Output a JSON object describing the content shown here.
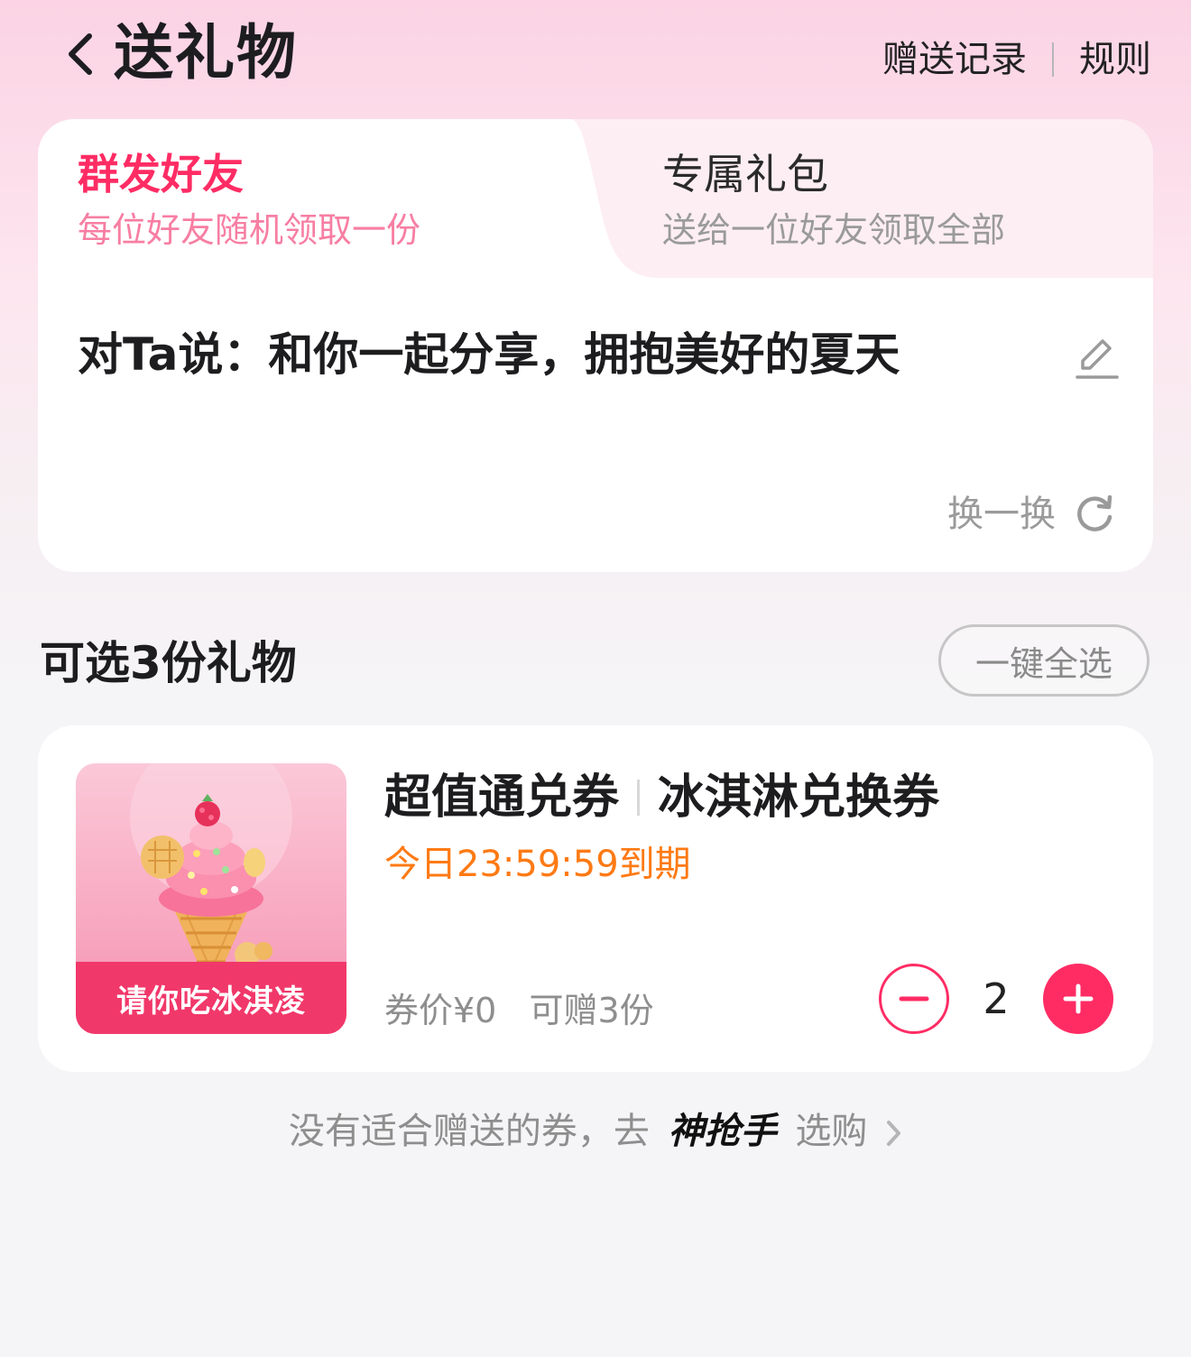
{
  "header": {
    "title": "送礼物",
    "links": [
      "赠送记录",
      "规则"
    ]
  },
  "tabs": [
    {
      "title": "群发好友",
      "subtitle": "每位好友随机领取一份",
      "active": true
    },
    {
      "title": "专属礼包",
      "subtitle": "送给一位好友领取全部",
      "active": false
    }
  ],
  "message": {
    "text": "对Ta说：和你一起分享，拥抱美好的夏天",
    "refresh_label": "换一换"
  },
  "gifts_section": {
    "title": "可选3份礼物",
    "select_all_label": "一键全选"
  },
  "gift": {
    "image_banner": "请你吃冰淇凌",
    "name": "超值通兑券",
    "type": "冰淇淋兑换券",
    "expiry": "今日23:59:59到期",
    "price": "券价¥0",
    "available": "可赠3份",
    "quantity": "2"
  },
  "footer": {
    "prefix": "没有适合赠送的券，去",
    "brand": "神抢手",
    "suffix": "选购"
  },
  "colors": {
    "accent": "#ff2c64",
    "expiry": "#ff7a14"
  }
}
